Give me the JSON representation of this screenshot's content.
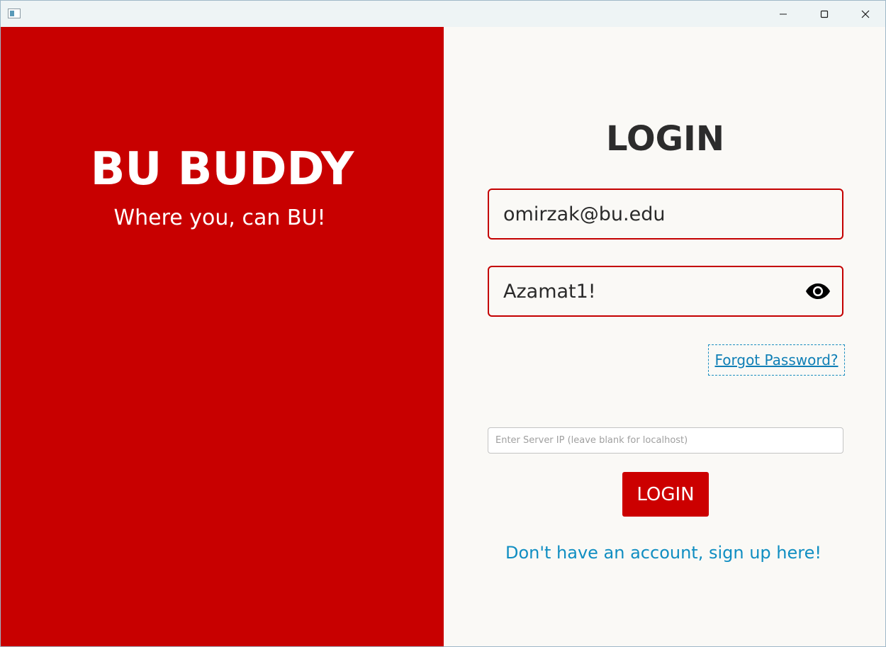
{
  "window": {
    "controls": {
      "minimize_icon": "minimize-icon",
      "maximize_icon": "maximize-icon",
      "close_icon": "close-icon"
    }
  },
  "brand": {
    "title": "BU BUDDY",
    "tagline": "Where you, can BU!",
    "color": "#c80000"
  },
  "login_form": {
    "heading": "LOGIN",
    "email_value": "omirzak@bu.edu",
    "password_value": "Azamat1!",
    "password_toggle_icon": "eye-icon",
    "forgot_password_label": "Forgot Password?",
    "server_ip_value": "",
    "server_ip_placeholder": "Enter Server IP (leave blank for localhost)",
    "login_button_label": "LOGIN",
    "signup_link_label": "Don't have an account, sign up here!",
    "accent_color": "#c40000",
    "link_color": "#108ec2"
  }
}
